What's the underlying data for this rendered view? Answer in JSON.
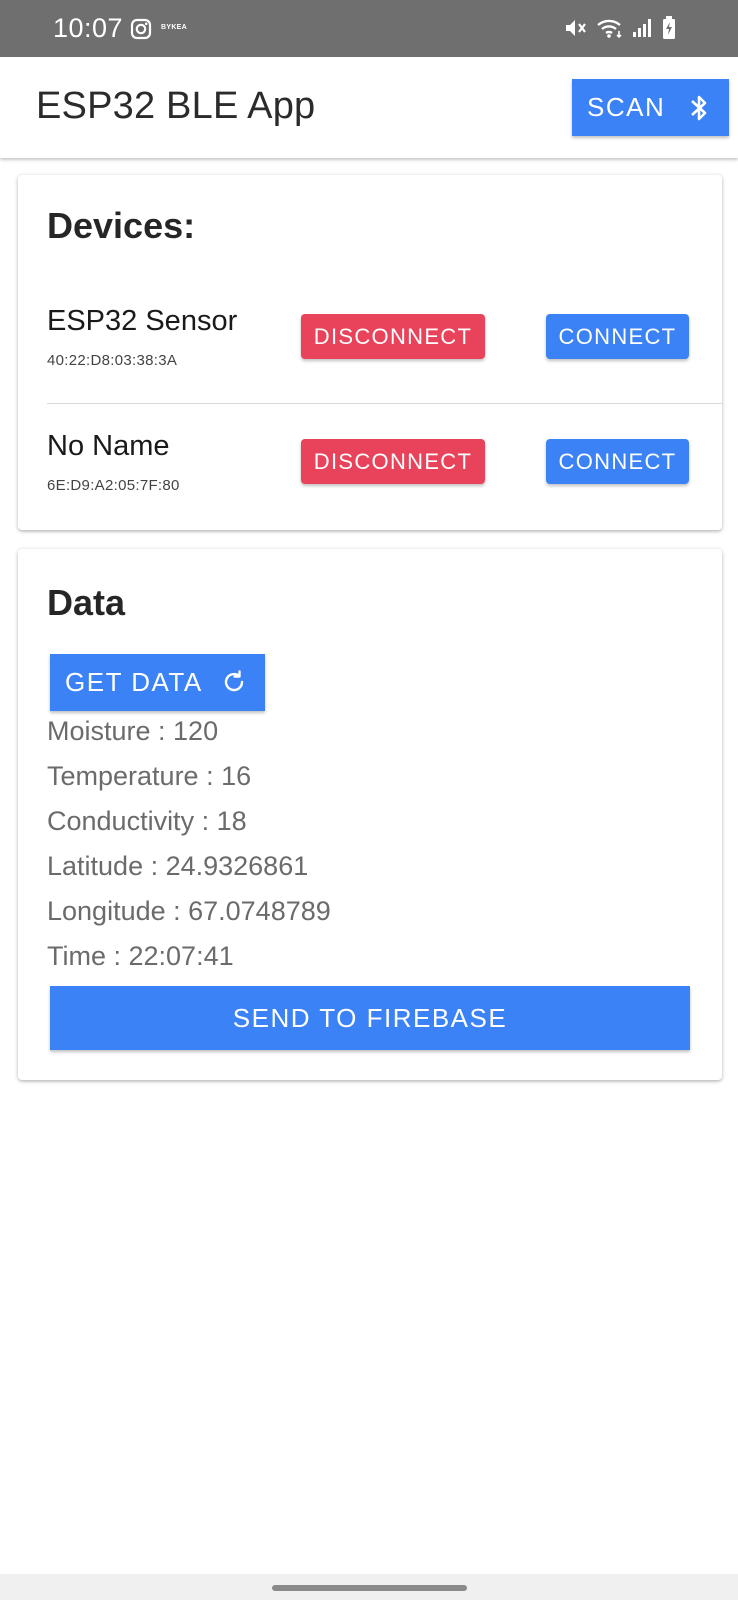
{
  "status_bar": {
    "time": "10:07",
    "brand_text": "BYKEA",
    "icons": [
      "instagram-icon",
      "mute-icon",
      "wifi-icon",
      "signal-icon",
      "battery-charging-icon"
    ]
  },
  "app_bar": {
    "title": "ESP32 BLE App",
    "scan_label": "SCAN",
    "scan_icon": "bluetooth-icon"
  },
  "devices": {
    "heading": "Devices:",
    "disconnect_label": "DISCONNECT",
    "connect_label": "CONNECT",
    "items": [
      {
        "name": "ESP32 Sensor",
        "address": "40:22:D8:03:38:3A"
      },
      {
        "name": "No Name",
        "address": "6E:D9:A2:05:7F:80"
      }
    ]
  },
  "data": {
    "heading": "Data",
    "get_data_label": "GET DATA",
    "get_data_icon": "refresh-icon",
    "readings": [
      "Moisture : 120",
      "Temperature : 16",
      "Conductivity : 18",
      "Latitude : 24.9326861",
      "Longitude : 67.0748789",
      "Time : 22:07:41"
    ],
    "send_label": "SEND TO FIREBASE"
  },
  "colors": {
    "primary": "#3b82f6",
    "danger": "#e8435a",
    "status_bar": "#6f6f6f"
  }
}
